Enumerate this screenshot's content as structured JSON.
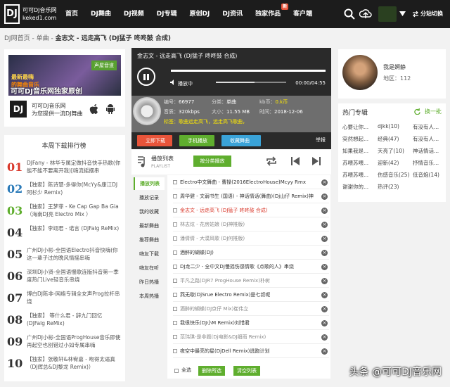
{
  "header": {
    "site_name_line1": "可可DJ音乐网",
    "site_name_line2": "keked1.com",
    "logo_glyph": "DJ",
    "nav": [
      "首页",
      "DJ舞曲",
      "DJ视频",
      "DJ专辑",
      "原创DJ",
      "DJ资讯",
      "独家作品",
      "客户端"
    ],
    "nav_badge": "新",
    "user_label": "分站切换"
  },
  "breadcrumb": {
    "home": "DJ网首页",
    "sep": " - ",
    "section": "单曲",
    "current": "金志文 - 远走高飞 (DJ猛子 咚咚鼓 合成)"
  },
  "banner": {
    "tag": "声屋音道",
    "line1": "最新最嗨",
    "line2": "的舞曲音乐",
    "caption": "可可DJ音乐网独家原创"
  },
  "app": {
    "line1": "可可DJ音乐网",
    "line2": "为您提供一流DJ舞曲"
  },
  "chart": {
    "title": "本周下载排行榜",
    "items": [
      {
        "num": "01",
        "color": "#d9382b",
        "text": "DJFany - 林华专属定做抖音快手热歌(你能不能不要离开我)[嗨流摇摆串"
      },
      {
        "num": "02",
        "color": "#2a7ab8",
        "text": "【独家】陈诗慧-多得你(McYy&康江DJ阿杉少 Remix)"
      },
      {
        "num": "03",
        "color": "#5fae2e",
        "text": "【独家】王梦菲 - Ke Cap Gap Ba Gia（海南DJ亮 Electro Mix ）"
      },
      {
        "num": "04",
        "color": "#333",
        "text": "【独家】李翊君 - 诺言 (DJFalg ReMix)"
      },
      {
        "num": "05",
        "color": "#333",
        "text": "广州DJ小彬-全国语Electro抖音快嗨(你这一辈子过的晚风情摇串嗨"
      },
      {
        "num": "06",
        "color": "#333",
        "text": "深圳DJ小贤-全国语慢歌连版抖音第一季度热门Live轻音乐串烧"
      },
      {
        "num": "07",
        "color": "#333",
        "text": "博白DJ陈非-网络专辑全女声Prog拉杆串烧"
      },
      {
        "num": "08",
        "color": "#333",
        "text": "【独家】 等什么君 - 辞九门回忆 (DJFalg ReMix)"
      },
      {
        "num": "09",
        "color": "#333",
        "text": "广州DJ小彬-全国语ProgHouse音乐即使再起空也别错过小如专属串嗨"
      },
      {
        "num": "10",
        "color": "#333",
        "text": "【独家】张敬轩&林宥嘉 - 吻得太逼真（DJ辉总&DJ黎龙 Remix)）"
      }
    ]
  },
  "player": {
    "title": "金志文 - 远走高飞 (DJ猛子 咚咚鼓 合成)",
    "state": "播放中",
    "time": "00:00/04:55",
    "volume": 0.55,
    "progress": 0.0
  },
  "track": {
    "id_label": "编号：",
    "id": "66977",
    "cat_label": "分类：",
    "cat": "单曲",
    "kbit_label": "kb币：",
    "kbit": "0.k币",
    "quality_label": "音质：",
    "quality": "320kbps",
    "size_label": "大小：",
    "size": "11.55 MB",
    "time_label": "时间：",
    "time": "2018-12-06",
    "tags": "标签：歌曲远走高飞，远走高飞歌曲，",
    "download": "立即下载",
    "mobile": "手机播放",
    "fav": "收藏舞曲",
    "report": "举报"
  },
  "playlist": {
    "title": "播放列表",
    "sub": "PLAYLIST",
    "play_all": "按分类播放",
    "menu": [
      "播放列表",
      "播放记录",
      "我的收藏",
      "最新舞曲",
      "推荐舞曲",
      "嗨友下载",
      "嗨友在听",
      "昨日热播",
      "本周热播"
    ],
    "items": [
      "Electro中文舞曲 - 曹操(2016ElectroHouse)Mcyy Rmx",
      "周华健 - 文弱书生 (国语) - 神话情话(舞曲)(Dj山仔 Remix)神",
      "金志文 - 远走高飞 (DJ猛子 咚咚鼓 合成)",
      "林志炫 - 花房姑娘 (DJ神推版)",
      "潘倩倩 - 大漠风歌 (DJ何推版)",
      "酒醉的蝴蝶(DJ)",
      "DJ龙二少 - 全中文DJ慢摇伤感情歌《点歌的人》串烧",
      "平凡之路(DJR7 ProgHouse Remix)朴树",
      "燕无歇(DjSrue Electro Remix)是七叔呢",
      "酒醉的蝴蝶(DJ京仔 Mix)崔伟立",
      "我很快乐(DJ小M Remix)刘惜君",
      "范玮琪-是非题(Dj电影&DJ细雨 Remix)",
      "夜空中最亮的星(DjDell Remix)逃跑计划"
    ],
    "select_all": "全选",
    "delete_sel": "删除所选",
    "clear": "清空列表"
  },
  "profile": {
    "name": "我是婀静",
    "area": "地区：112"
  },
  "albums": {
    "title": "热门专辑",
    "change": "换一批",
    "items": [
      [
        "心要让你...",
        "djkk(10)",
        "有没有人..."
      ],
      [
        "突然想起...",
        "经典(47)",
        "有没有人..."
      ],
      [
        "如果我是...",
        "天亮了(10)",
        "神话情话..."
      ],
      [
        "苏喂苏喂...",
        "迎新(42)",
        "抒情音乐..."
      ],
      [
        "苏喂苏喂...",
        "伤感音乐(25)",
        "低音炮(14)"
      ],
      [
        "谢谢你的...",
        "热评(23)",
        ""
      ]
    ]
  },
  "watermark": "头条 @可可DJ音乐网",
  "colors": {
    "accent": "#5fae2e",
    "download": "#e8543a",
    "mobile": "#5fae2e",
    "fav": "#3aa3d8",
    "current_track": "#d9382b"
  }
}
